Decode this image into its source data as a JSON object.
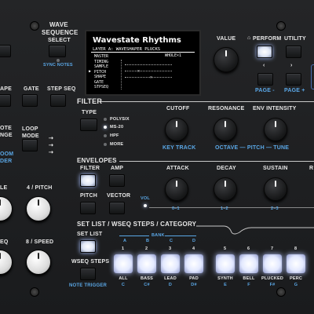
{
  "wave_sequence": {
    "title_line1": "WAVE",
    "title_line2": "SEQUENCE",
    "select_label": "SELECT",
    "sync_notes_label": "SYNC NOTES"
  },
  "left_column": {
    "ape_label": "APE",
    "gate_label": "GATE",
    "step_seq_label": "STEP SEQ",
    "note_label_partial": "OTE",
    "change_label_partial": "NGE",
    "loop_mode_label": "LOOP MODE",
    "room_label_partial": "OOM",
    "der_label_partial": "DER",
    "le_label_partial": "LE",
    "pitch_label": "4 / PITCH",
    "eq_label_partial": "EQ",
    "speed_label": "8 / SPEED"
  },
  "display": {
    "title": "Wavestate Rhythms",
    "subtitle": "LAYER A: WAVESHAPER PLUCKS",
    "rows": [
      "MASTER",
      "TIMING",
      "SAMPLE",
      "PITCH",
      "SHAPE",
      "GATE",
      "STPSEQ"
    ],
    "header_right": "WHOLE×1",
    "cursor": "▶"
  },
  "right_top": {
    "value_label": "VALUE",
    "perform_label": "PERFORM",
    "utility_label": "UTILITY",
    "page_minus": "PAGE -",
    "page_plus": "PAGE +"
  },
  "filter": {
    "section": "FILTER",
    "type_label": "TYPE",
    "types": [
      "POLYSIX",
      "MS-20",
      "HPF",
      "MORE"
    ],
    "selected_type": "MS-20",
    "cutoff": "CUTOFF",
    "resonance": "RESONANCE",
    "env_intensity": "ENV INTENSITY",
    "key_track": "KEY TRACK",
    "octave_pitch_tune": "OCTAVE — PITCH — TUNE"
  },
  "envelopes": {
    "section": "ENVELOPES",
    "filter": "FILTER",
    "amp": "AMP",
    "pitch": "PITCH",
    "vector": "VECTOR",
    "vol": "VOL",
    "attack": "ATTACK",
    "decay": "DECAY",
    "sustain": "SUSTAIN",
    "r_partial": "R",
    "attack_range": "0–1",
    "decay_range": "1–2",
    "sustain_range": "2–3"
  },
  "set_list": {
    "section": "SET LIST / WSEQ STEPS / CATEGORY",
    "set_list_label": "SET LIST",
    "bank_label": "BANK",
    "wseq_steps": "WSEQ STEPS",
    "note_trigger": "NOTE TRIGGER",
    "bank_letters": [
      "A",
      "B",
      "C",
      "D"
    ],
    "pads": [
      {
        "num": "1",
        "name": "ALL",
        "note": "C"
      },
      {
        "num": "2",
        "name": "BASS",
        "note": "C#"
      },
      {
        "num": "3",
        "name": "LEAD",
        "note": "D"
      },
      {
        "num": "4",
        "name": "PAD",
        "note": "D#"
      },
      {
        "num": "5",
        "name": "SYNTH",
        "note": "E"
      },
      {
        "num": "6",
        "name": "BELL",
        "note": "F"
      },
      {
        "num": "7",
        "name": "PLUCKED",
        "note": "F#"
      },
      {
        "num": "8",
        "name": "PERC",
        "note": "G"
      }
    ]
  }
}
